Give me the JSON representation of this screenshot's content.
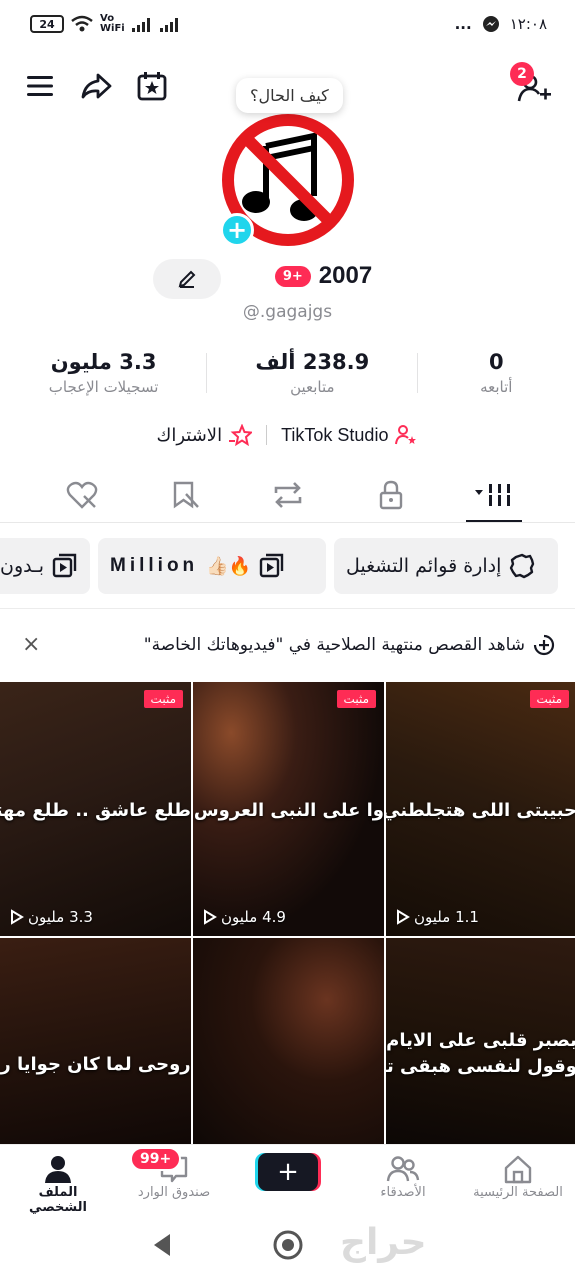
{
  "status_bar": {
    "battery": "24",
    "network": "Vo WiFi",
    "time": "١٢:٠٨",
    "dots": "..."
  },
  "header": {
    "follow_requests_badge": "2"
  },
  "profile": {
    "speech_bubble": "كيف الحال؟",
    "name": "2007",
    "name_badge": "9+",
    "handle": "@.gagajgs"
  },
  "stats": [
    {
      "value": "0",
      "label": "أتابعه"
    },
    {
      "value": "238.9 ألف",
      "label": "متابعين"
    },
    {
      "value": "3.3 مليون",
      "label": "تسجيلات الإعجاب"
    }
  ],
  "links": {
    "studio": "TikTok Studio",
    "subscription": "الاشتراك"
  },
  "chips": {
    "playlists": "إدارة قوائم التشغيل",
    "million": "Million",
    "million_emoji": "👍🏻🔥",
    "partial": "بـدون"
  },
  "notice": {
    "text": "شاهد القصص منتهية الصلاحية في \"فيديوهاتك الخاصة\""
  },
  "videos": [
    {
      "pin": "مثبت",
      "overlay": "حبيبتى اللى هتجلطني",
      "views": "1.1 مليون"
    },
    {
      "pin": "مثبت",
      "overlay": "وا على النبى العروس غ",
      "views": "4.9 مليون"
    },
    {
      "pin": "مثبت",
      "overlay": "طلع عاشق .. طلع مهتم",
      "views": "3.3 مليون"
    },
    {
      "overlay": "بصبر قلبى على الايام",
      "overlay2": "وقول لنفسى هبقى تمام"
    },
    {
      "overlay": ""
    },
    {
      "overlay": "روحى لما كان جوايا ر"
    }
  ],
  "bottom_nav": {
    "home": "الصفحة الرئيسية",
    "friends": "الأصدقاء",
    "create": "+",
    "inbox": "صندوق الوارد",
    "inbox_badge": "99+",
    "profile": "الملف الشخصي"
  },
  "watermark": "حراج",
  "colors": {
    "accent": "#fe2c55",
    "cyan": "#20d5ec",
    "text": "#161823",
    "secondary": "#8a8b91"
  }
}
